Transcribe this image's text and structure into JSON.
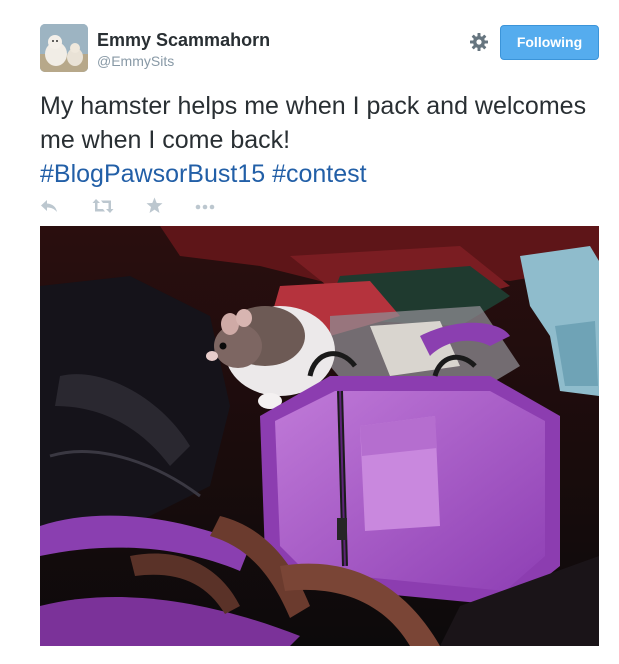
{
  "user": {
    "name": "Emmy Scammahorn",
    "handle": "@EmmySits"
  },
  "follow_button": {
    "label": "Following"
  },
  "tweet": {
    "text": "My hamster helps me when I pack and welcomes me when I come back!",
    "hashtags": [
      "#BlogPawsorBust15",
      "#contest"
    ]
  },
  "icons": {
    "settings": "gear-icon",
    "reply": "reply-icon",
    "retweet": "retweet-icon",
    "favorite": "star-icon",
    "more": "more-icon"
  },
  "colors": {
    "follow_button": "#55acee",
    "hashtag": "#225fa7",
    "action_icons": "#bcc7cf",
    "bag": "#a24fc4"
  }
}
